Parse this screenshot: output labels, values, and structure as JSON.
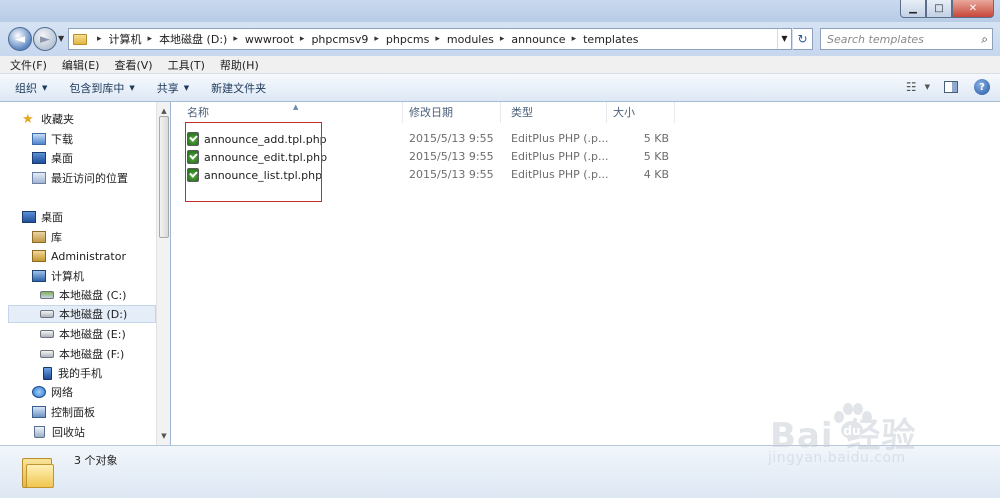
{
  "window": {
    "minimize_glyph": "▁",
    "maximize_glyph": "□",
    "close_glyph": "✕"
  },
  "navigation": {
    "back_glyph": "◄",
    "forward_glyph": "►",
    "history_dropdown_glyph": "▼",
    "breadcrumb_separator": "▸",
    "breadcrumbs": [
      "计算机",
      "本地磁盘 (D:)",
      "wwwroot",
      "phpcmsv9",
      "phpcms",
      "modules",
      "announce",
      "templates"
    ],
    "refresh_glyph": "↻",
    "search_placeholder": "Search templates",
    "search_icon_glyph": "⌕"
  },
  "menu": {
    "items": [
      "文件(F)",
      "编辑(E)",
      "查看(V)",
      "工具(T)",
      "帮助(H)"
    ]
  },
  "commands": {
    "organize": "组织",
    "include_in_library": "包含到库中",
    "share": "共享",
    "new_folder": "新建文件夹",
    "dropdown_glyph": "▼",
    "view_glyph": "☷",
    "help_glyph": "?"
  },
  "nav_pane": {
    "favorites": "收藏夹",
    "downloads": "下载",
    "desktop_fav": "桌面",
    "recent_places": "最近访问的位置",
    "desktop": "桌面",
    "library": "库",
    "user": "Administrator",
    "computer": "计算机",
    "drive_c": "本地磁盘 (C:)",
    "drive_d": "本地磁盘 (D:)",
    "drive_e": "本地磁盘 (E:)",
    "drive_f": "本地磁盘 (F:)",
    "phone": "我的手机",
    "network": "网络",
    "control_panel": "控制面板",
    "recycle_bin": "回收站",
    "star_glyph": "★",
    "scroll_up_glyph": "▲",
    "scroll_down_glyph": "▼"
  },
  "file_list": {
    "columns": {
      "name": "名称",
      "modified": "修改日期",
      "type": "类型",
      "size": "大小",
      "sort_glyph": "▲"
    },
    "rows": [
      {
        "name": "announce_add.tpl.php",
        "modified": "2015/5/13 9:55",
        "type": "EditPlus PHP (.p...",
        "size": "5 KB"
      },
      {
        "name": "announce_edit.tpl.php",
        "modified": "2015/5/13 9:55",
        "type": "EditPlus PHP (.p...",
        "size": "5 KB"
      },
      {
        "name": "announce_list.tpl.php",
        "modified": "2015/5/13 9:55",
        "type": "EditPlus PHP (.p...",
        "size": "4 KB"
      }
    ],
    "highlight_color": "#c0302c"
  },
  "status": {
    "item_count": "3 个对象"
  },
  "watermark": {
    "logo": "Bai  经验",
    "url": "jingyan.baidu.com"
  }
}
